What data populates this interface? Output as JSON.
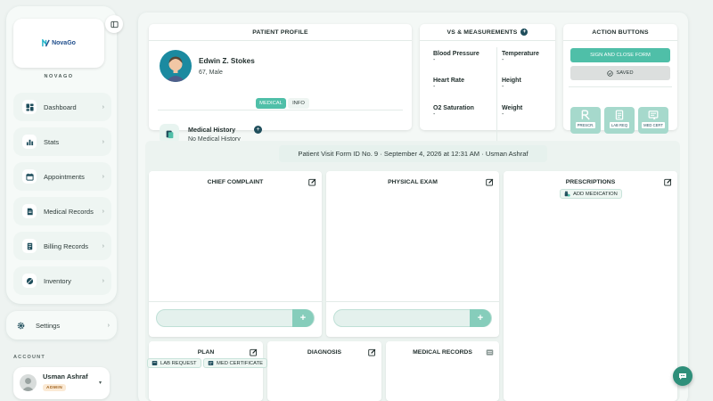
{
  "brand": {
    "logo_text": "NovaGo",
    "caption": "NOVAGO"
  },
  "sidebar": {
    "items": [
      {
        "label": "Dashboard",
        "icon": "dashboard-icon"
      },
      {
        "label": "Stats",
        "icon": "bar-chart-icon"
      },
      {
        "label": "Appointments",
        "icon": "calendar-icon"
      },
      {
        "label": "Medical Records",
        "icon": "document-icon"
      },
      {
        "label": "Billing Records",
        "icon": "receipt-icon"
      },
      {
        "label": "Inventory",
        "icon": "pill-icon"
      }
    ],
    "chevron": "›",
    "settings_label": "Settings",
    "account_caption": "ACCOUNT",
    "account": {
      "name": "Usman Ashraf",
      "role": "ADMIN",
      "caret": "▾"
    }
  },
  "patient_profile": {
    "title": "PATIENT PROFILE",
    "name": "Edwin Z. Stokes",
    "info": "67, Male",
    "tabs": [
      "MEDICAL",
      "INFO"
    ],
    "medical_history_title": "Medical History",
    "medical_history_value": "No Medical History"
  },
  "vitals": {
    "title": "VS & MEASUREMENTS",
    "items": [
      {
        "label": "Blood Pressure",
        "value": "-"
      },
      {
        "label": "Temperature",
        "value": "-"
      },
      {
        "label": "Heart Rate",
        "value": "-"
      },
      {
        "label": "Height",
        "value": "-"
      },
      {
        "label": "O2 Saturation",
        "value": "-"
      },
      {
        "label": "Weight",
        "value": "-"
      }
    ]
  },
  "actions": {
    "title": "ACTION BUTTONS",
    "sign_close": "SIGN AND CLOSE FORM",
    "saved": "SAVED",
    "docs": [
      "PRESCR.",
      "LAB REQ",
      "MED CERT"
    ]
  },
  "visit": {
    "header": "Patient Visit Form ID No. 9 · September 4, 2026 at 12:31 AM · Usman Ashraf",
    "chief_complaint": "CHIEF COMPLAINT",
    "physical_exam": "PHYSICAL EXAM",
    "prescriptions": "PRESCRIPTIONS",
    "add_medication": "ADD MEDICATION",
    "plan": "PLAN",
    "diagnosis": "DIAGNOSIS",
    "medical_records": "MEDICAL RECORDS",
    "lab_request": "LAB REQUEST",
    "med_certificate": "MED CERTIFICATE",
    "add_symbol": "+"
  },
  "colors": {
    "accent": "#4fbfa8",
    "dark": "#1f4e5c",
    "background": "#eef3f1"
  }
}
